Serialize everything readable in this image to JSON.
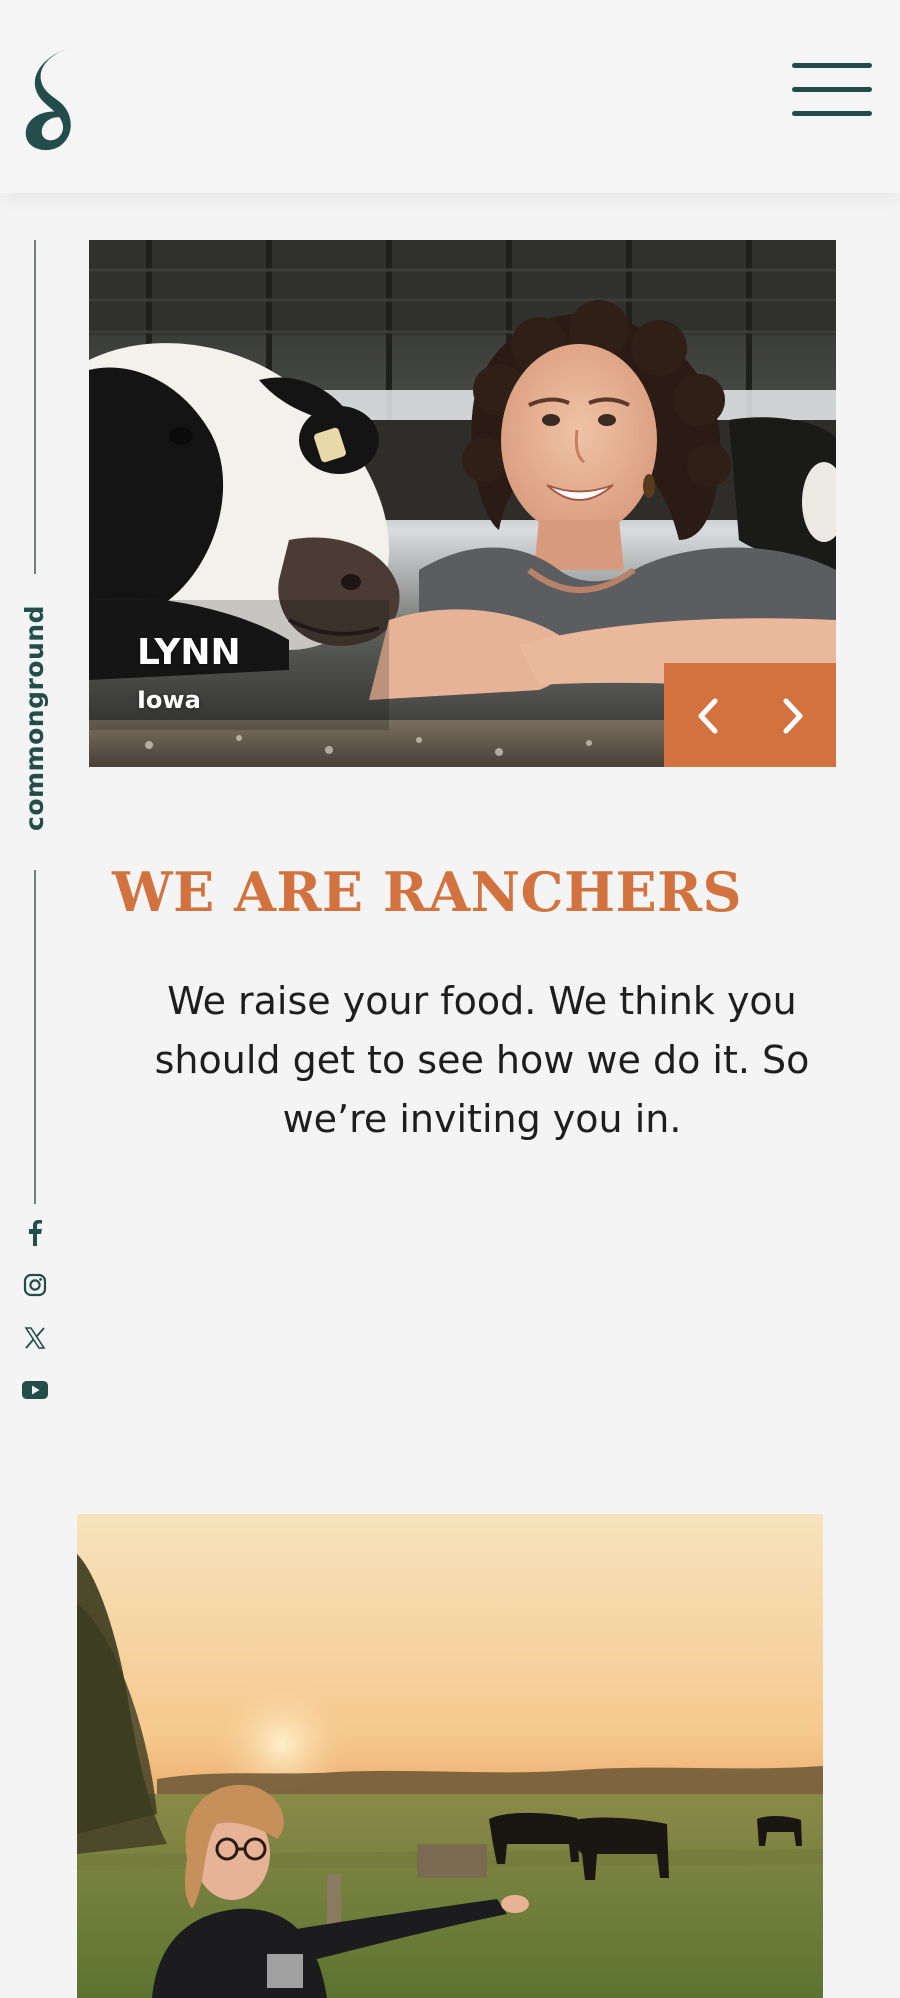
{
  "header": {
    "logo_icon": "commonground-logo-icon",
    "menu_icon": "hamburger-menu-icon"
  },
  "rail": {
    "brand": "commonground",
    "social": [
      "facebook-icon",
      "instagram-icon",
      "x-twitter-icon",
      "youtube-icon"
    ]
  },
  "hero": {
    "name": "LYNN",
    "location": "Iowa",
    "prev_icon": "chevron-left-icon",
    "next_icon": "chevron-right-icon"
  },
  "section": {
    "title": "WE ARE RANCHERS",
    "body": "We raise your food. We think you should get to see how we do it. So we’re inviting you in."
  },
  "colors": {
    "accent": "#d2733f",
    "brand_dark": "#234d4b",
    "background": "#f4f4f4"
  }
}
